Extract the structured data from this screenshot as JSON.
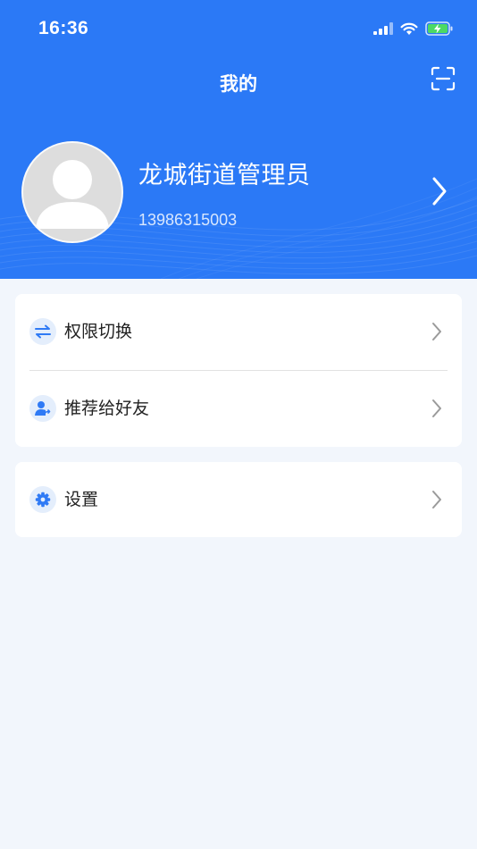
{
  "status_bar": {
    "time": "16:36",
    "icons": [
      "cellular-signal-icon",
      "wifi-icon",
      "battery-charging-icon"
    ]
  },
  "nav": {
    "title": "我的",
    "scan_icon": "scan-icon"
  },
  "profile": {
    "name": "龙城街道管理员",
    "phone": "13986315003",
    "avatar_icon": "default-avatar-icon",
    "chevron_icon": "chevron-right-icon"
  },
  "menu": {
    "group1": [
      {
        "label": "权限切换",
        "icon": "swap-arrows-icon"
      },
      {
        "label": "推荐给好友",
        "icon": "share-user-icon"
      }
    ],
    "group2": [
      {
        "label": "设置",
        "icon": "gear-icon"
      }
    ]
  },
  "colors": {
    "primary": "#2b79f6",
    "background": "#f2f6fc",
    "icon_bg": "#e4eefc",
    "icon_fg": "#2f7af5",
    "text": "#222222",
    "chevron": "#9a9a9a"
  }
}
